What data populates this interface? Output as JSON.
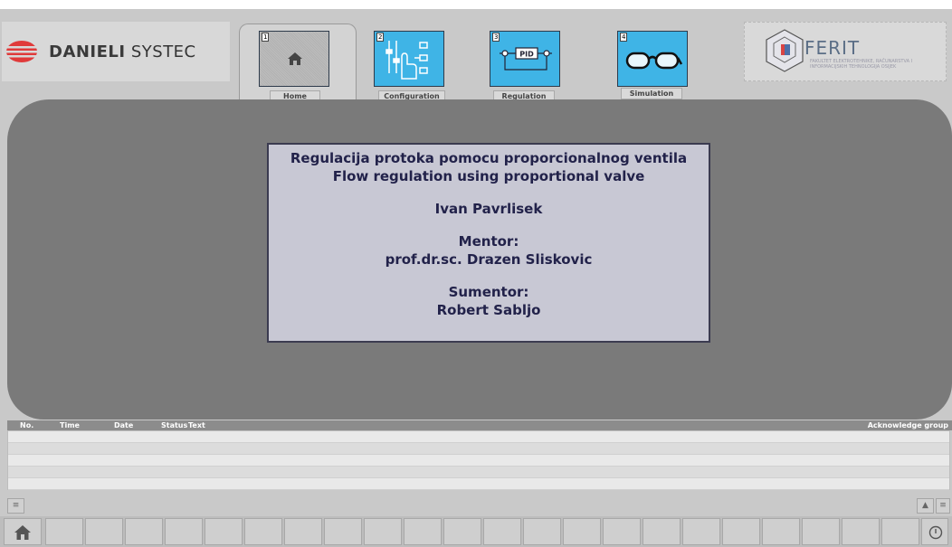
{
  "header": {
    "danieli_logo": {
      "brand": "DANIELI",
      "suffix": "SYSTEC"
    },
    "nav": [
      {
        "number": "1",
        "label": "Home",
        "icon": "home-icon"
      },
      {
        "number": "2",
        "label": "Configuration",
        "icon": "touch-configuration-icon"
      },
      {
        "number": "3",
        "label": "Regulation",
        "icon": "pid-loop-icon"
      },
      {
        "number": "4",
        "label": "Simulation",
        "icon": "glasses-icon"
      }
    ],
    "ferit_logo": {
      "title": "FERIT",
      "subtitle": "FAKULTET ELEKTROTEHNIKE, RAČUNARSTVA I INFORMACIJSKIH TEHNOLOGIJA OSIJEK"
    }
  },
  "title_box": {
    "line1": "Regulacija protoka pomocu proporcionalnog ventila",
    "line2": "Flow regulation using proportional valve",
    "author": "Ivan Pavrlisek",
    "mentor_label": "Mentor:",
    "mentor_name": "prof.dr.sc. Drazen Sliskovic",
    "sumentor_label": "Sumentor:",
    "sumentor_name": "Robert Sabljo"
  },
  "alarm_view": {
    "columns": [
      "No.",
      "Time",
      "Date",
      "Status",
      "Text"
    ],
    "right_column": "Acknowledge group"
  },
  "colors": {
    "background": "#c9c9c9",
    "main_panel": "#7a7a7a",
    "title_box_bg": "#c8c8d4",
    "title_text": "#22224a",
    "nav_icon_bg": "#3fb4e6"
  }
}
